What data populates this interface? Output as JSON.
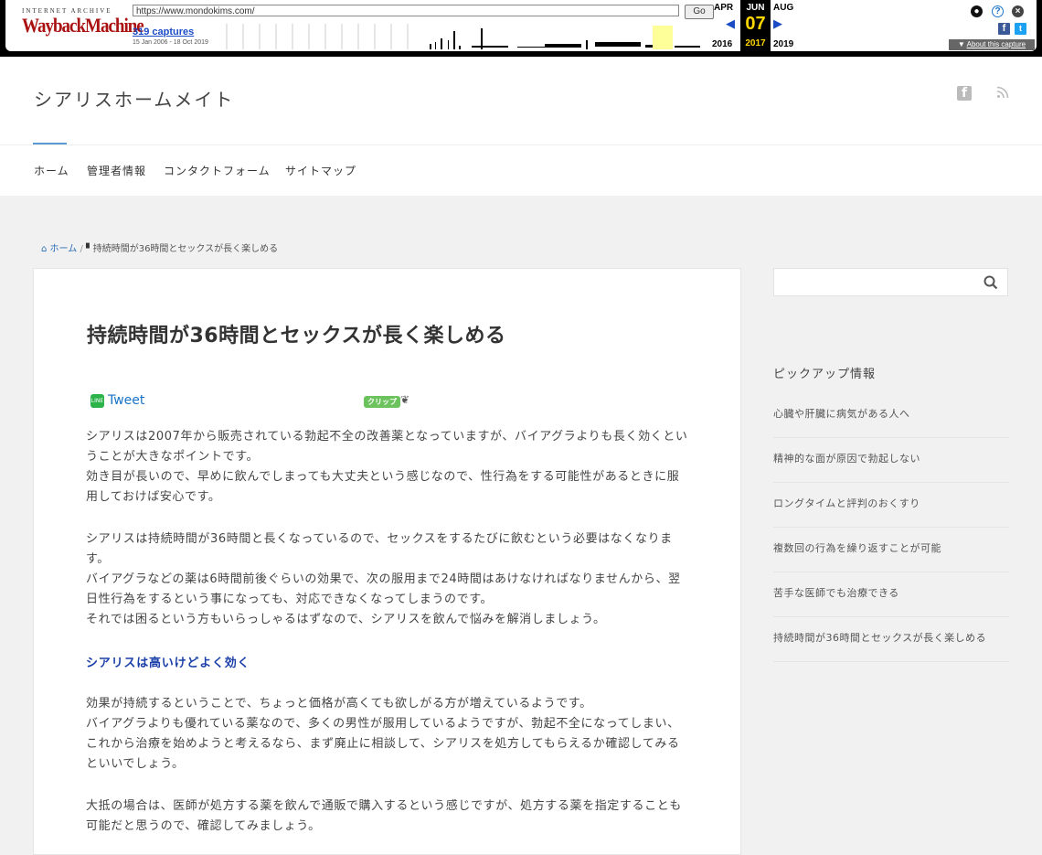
{
  "wayback": {
    "logo_top": "INTERNET ARCHIVE",
    "logo": "WaybackMachine",
    "url": "https://www.mondokims.com/",
    "go_label": "Go",
    "captures": "319 captures",
    "range": "15 Jan 2006 - 18 Oct 2019",
    "prev_month": "APR",
    "cur_month": "JUN",
    "next_month": "AUG",
    "day": "07",
    "prev_year": "2016",
    "cur_year": "2017",
    "next_year": "2019",
    "about": "About this capture",
    "icons": [
      "account-icon",
      "help-icon",
      "close-icon",
      "facebook-icon",
      "twitter-icon"
    ]
  },
  "site": {
    "title": "シアリスホームメイト",
    "icons": [
      "facebook-icon",
      "rss-icon"
    ]
  },
  "nav": {
    "items": [
      "ホーム",
      "管理者情報",
      "コンタクトフォーム",
      "サイトマップ"
    ]
  },
  "breadcrumb": {
    "home": "ホーム",
    "sep": "/",
    "current": "持続時間が36時間とセックスが長く楽しめる"
  },
  "article": {
    "title": "持続時間が36時間とセックスが長く楽しめる",
    "tweet": "Tweet",
    "clip": "クリップ",
    "p1": "シアリスは2007年から販売されている勃起不全の改善薬となっていますが、バイアグラよりも長く効くということが大きなポイントです。\n効き目が長いので、早めに飲んでしまっても大丈夫という感じなので、性行為をする可能性があるときに服用しておけば安心です。",
    "p2": "シアリスは持続時間が36時間と長くなっているので、セックスをするたびに飲むという必要はなくなります。\nバイアグラなどの薬は6時間前後ぐらいの効果で、次の服用まで24時間はあけなければなりませんから、翌日性行為をするという事になっても、対応できなくなってしまうのです。\nそれでは困るという方もいらっしゃるはずなので、シアリスを飲んで悩みを解消しましょう。",
    "subhead": "シアリスは高いけどよく効く",
    "p3": "効果が持続するということで、ちょっと価格が高くても欲しがる方が増えているようです。\nバイアグラよりも優れている薬なので、多くの男性が服用しているようですが、勃起不全になってしまい、これから治療を始めようと考えるなら、まず廃止に相談して、シアリスを処方してもらえるか確認してみるといいでしょう。",
    "p4": "大抵の場合は、医師が処方する薬を飲んで通販で購入するという感じですが、処方する薬を指定することも可能だと思うので、確認してみましょう。"
  },
  "sidebar": {
    "search_placeholder": "",
    "title": "ピックアップ情報",
    "items": [
      "心臓や肝臓に病気がある人へ",
      "精神的な面が原因で勃起しない",
      "ロングタイムと評判のおくすり",
      "複数回の行為を繰り返すことが可能",
      "苦手な医師でも治療できる",
      "持続時間が36時間とセックスが長く楽しめる"
    ]
  }
}
